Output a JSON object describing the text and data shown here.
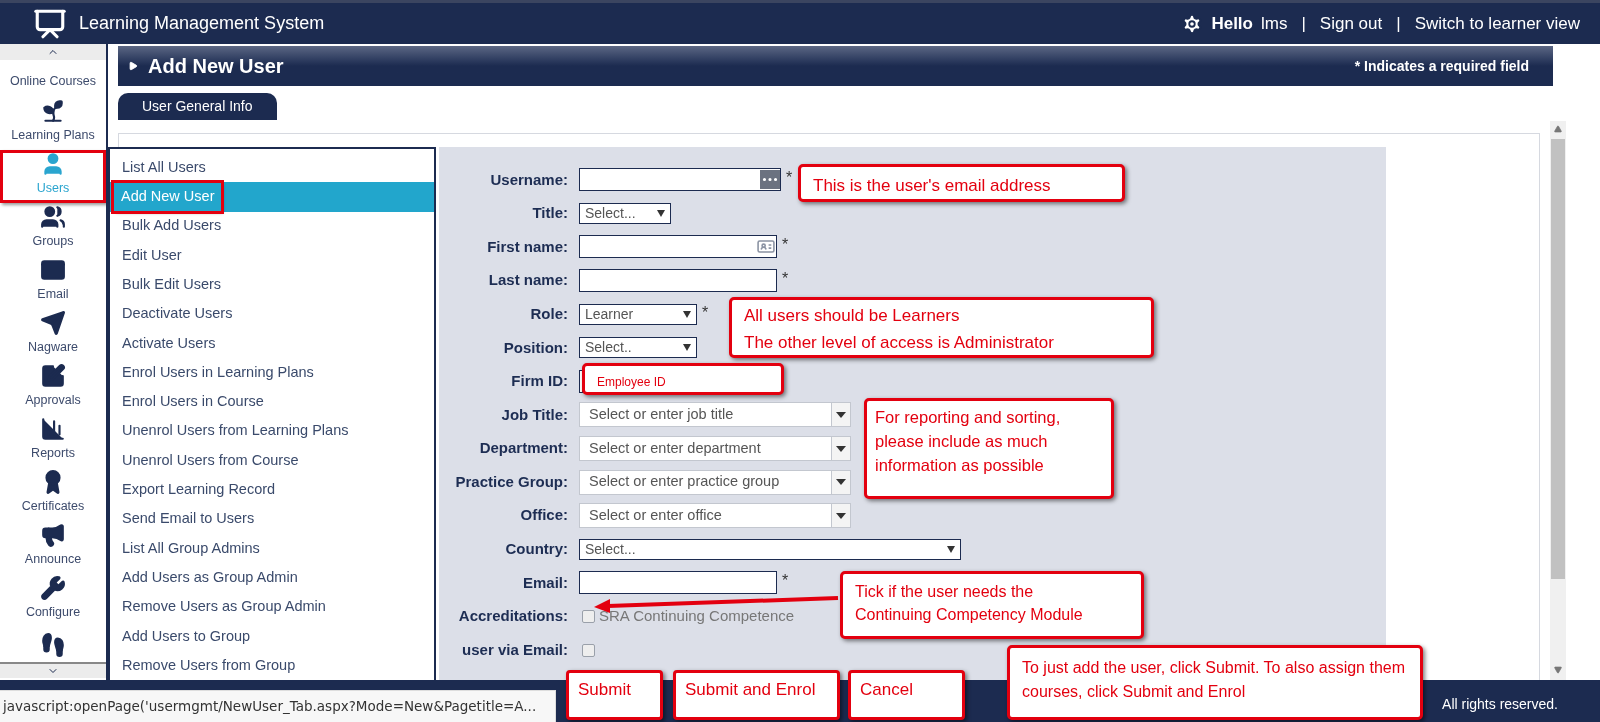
{
  "header": {
    "title": "Learning Management System",
    "greeting": "Hello",
    "user": "lms",
    "links": [
      {
        "label": "Sign out"
      },
      {
        "label": "Switch to learner view"
      }
    ],
    "separator": "|"
  },
  "sidebar": {
    "items": [
      {
        "label": "Online Courses",
        "selected": false,
        "highlighted": false
      },
      {
        "label": "Learning Plans",
        "selected": false,
        "highlighted": false
      },
      {
        "label": "Users",
        "selected": true,
        "highlighted": true
      },
      {
        "label": "Groups",
        "selected": false,
        "highlighted": false
      },
      {
        "label": "Email",
        "selected": false,
        "highlighted": false
      },
      {
        "label": "Nagware",
        "selected": false,
        "highlighted": false
      },
      {
        "label": "Approvals",
        "selected": false,
        "highlighted": false
      },
      {
        "label": "Reports",
        "selected": false,
        "highlighted": false
      },
      {
        "label": "Certificates",
        "selected": false,
        "highlighted": false
      },
      {
        "label": "Announce",
        "selected": false,
        "highlighted": false
      },
      {
        "label": "Configure",
        "selected": false,
        "highlighted": false
      },
      {
        "selected": false,
        "highlighted": false
      }
    ]
  },
  "page": {
    "title": "Add New User",
    "required_note": "* Indicates a required field",
    "tabs": [
      {
        "label": "User General Info",
        "selected": true
      }
    ]
  },
  "menu": {
    "items": [
      {
        "label": "List All Users",
        "selected": false,
        "highlighted": false
      },
      {
        "label": "Add New User",
        "selected": true,
        "highlighted": true
      },
      {
        "label": "Bulk Add Users",
        "selected": false,
        "highlighted": false
      },
      {
        "label": "Edit User",
        "selected": false,
        "highlighted": false
      },
      {
        "label": "Bulk Edit Users",
        "selected": false,
        "highlighted": false
      },
      {
        "label": "Deactivate Users",
        "selected": false,
        "highlighted": false
      },
      {
        "label": "Activate Users",
        "selected": false,
        "highlighted": false
      },
      {
        "label": "Enrol Users in Learning Plans",
        "selected": false,
        "highlighted": false
      },
      {
        "label": "Enrol Users in Course",
        "selected": false,
        "highlighted": false
      },
      {
        "label": "Unenrol Users from Learning Plans",
        "selected": false,
        "highlighted": false
      },
      {
        "label": "Unenrol Users from Course",
        "selected": false,
        "highlighted": false
      },
      {
        "label": "Export Learning Record",
        "selected": false,
        "highlighted": false
      },
      {
        "label": "Send Email to Users",
        "selected": false,
        "highlighted": false
      },
      {
        "label": "List All Group Admins",
        "selected": false,
        "highlighted": false
      },
      {
        "label": "Add Users as Group Admin",
        "selected": false,
        "highlighted": false
      },
      {
        "label": "Remove Users as Group Admin",
        "selected": false,
        "highlighted": false
      },
      {
        "label": "Add Users to Group",
        "selected": false,
        "highlighted": false
      },
      {
        "label": "Remove Users from Group",
        "selected": false,
        "highlighted": false
      }
    ]
  },
  "form": {
    "fields": [
      {
        "label": "Username:",
        "kind": "text",
        "required_mark": "*"
      },
      {
        "label": "Title:",
        "kind": "select",
        "value": "Select..."
      },
      {
        "label": "First name:",
        "kind": "text",
        "required_mark": "*"
      },
      {
        "label": "Last name:",
        "kind": "text",
        "required_mark": "*"
      },
      {
        "label": "Role:",
        "kind": "select",
        "value": "Learner",
        "required_mark": "*"
      },
      {
        "label": "Position:",
        "kind": "select",
        "value": "Select.."
      },
      {
        "label": "Firm ID:",
        "kind": "text"
      },
      {
        "label": "Job Title:",
        "kind": "combo",
        "placeholder": "Select or enter job title"
      },
      {
        "label": "Department:",
        "kind": "combo",
        "placeholder": "Select or enter department"
      },
      {
        "label": "Practice Group:",
        "kind": "combo",
        "placeholder": "Select or enter practice group"
      },
      {
        "label": "Office:",
        "kind": "combo",
        "placeholder": "Select or enter office"
      },
      {
        "label": "Country:",
        "kind": "select",
        "value": "Select..."
      },
      {
        "label": "Email:",
        "kind": "text",
        "required_mark": "*"
      },
      {
        "label": "Accreditations:",
        "kind": "checkbox",
        "option": "SRA Continuing Competence",
        "checked": false
      },
      {
        "label": "user via Email:",
        "kind": "checkbox",
        "checked": false
      }
    ]
  },
  "actions": [
    {
      "label": "Submit"
    },
    {
      "label": "Submit and Enrol"
    },
    {
      "label": "Cancel"
    }
  ],
  "annotations": [
    {
      "kind": "note",
      "lines": [
        "This is the user's email address"
      ]
    },
    {
      "kind": "note",
      "lines": [
        "All users should be Learners",
        "The other level of access is Administrator"
      ]
    },
    {
      "kind": "small",
      "lines": [
        "Employee ID"
      ]
    },
    {
      "kind": "note",
      "lines": [
        "For reporting and sorting, please include as much information as possible"
      ]
    },
    {
      "kind": "arrow_note",
      "lines": [
        "Tick if the user needs the",
        "Continuing Competency Module"
      ]
    },
    {
      "kind": "note",
      "lines": [
        "To just add the user, click Submit. To also assign them courses, click Submit and Enrol"
      ]
    }
  ],
  "footer": {
    "copyright": "All rights reserved."
  },
  "status_bar": {
    "text": "javascript:openPage('usermgmt/NewUser_Tab.aspx?Mode=New&Pagetitle=A..."
  }
}
